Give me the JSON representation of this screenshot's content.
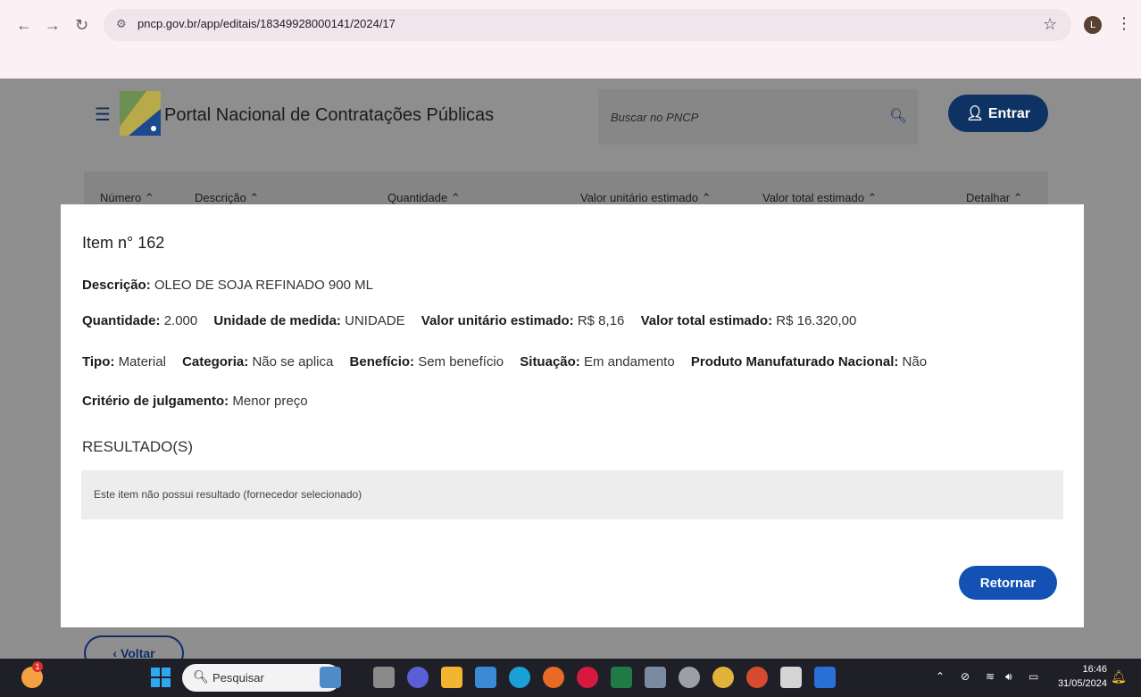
{
  "browser": {
    "url": "pncp.gov.br/app/editais/18349928000141/2024/17",
    "profile_initial": "L"
  },
  "site": {
    "title": "Portal Nacional de Contratações Públicas",
    "search_placeholder": "Buscar no PNCP",
    "login_label": "Entrar",
    "table_headers": [
      "Número",
      "Descrição",
      "Quantidade",
      "Valor unitário estimado",
      "Valor total estimado",
      "Detalhar"
    ],
    "back_label": "Voltar"
  },
  "modal": {
    "title": "Item n° 162",
    "descricao_label": "Descrição:",
    "descricao_value": "OLEO DE SOJA REFINADO 900 ML",
    "quantidade_label": "Quantidade:",
    "quantidade_value": "2.000",
    "unidade_label": "Unidade de medida:",
    "unidade_value": "UNIDADE",
    "vunit_label": "Valor unitário estimado:",
    "vunit_value": "R$ 8,16",
    "vtotal_label": "Valor total estimado:",
    "vtotal_value": "R$ 16.320,00",
    "tipo_label": "Tipo:",
    "tipo_value": "Material",
    "categoria_label": "Categoria:",
    "categoria_value": "Não se aplica",
    "beneficio_label": "Benefício:",
    "beneficio_value": "Sem benefício",
    "situacao_label": "Situação:",
    "situacao_value": "Em andamento",
    "produto_label": "Produto Manufaturado Nacional:",
    "produto_value": "Não",
    "criterio_label": "Critério de julgamento:",
    "criterio_value": "Menor preço",
    "resultados_title": "RESULTADO(S)",
    "resultados_empty": "Este item não possui resultado (fornecedor selecionado)",
    "return_label": "Retornar"
  },
  "taskbar": {
    "search_label": "Pesquisar",
    "time": "16:46",
    "date": "31/05/2024",
    "notification_count": "1"
  },
  "colors": {
    "primary": "#1351b4",
    "header_dark": "#0f3264",
    "modal_bg": "#ffffff",
    "overlay": "#8f8f8f"
  }
}
